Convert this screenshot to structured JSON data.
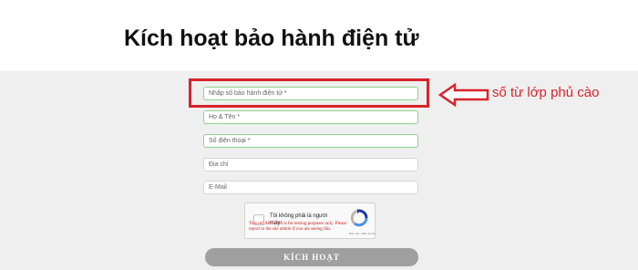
{
  "header": {
    "title": "Kích hoạt bảo hành điện tử"
  },
  "form": {
    "fields": [
      {
        "placeholder": "Nhập số bảo hành điện tử *"
      },
      {
        "placeholder": "Họ & Tên *"
      },
      {
        "placeholder": "Số điện thoại *"
      },
      {
        "placeholder": "Địa chỉ"
      },
      {
        "placeholder": "E-Mail"
      }
    ],
    "recaptcha": {
      "label": "Tôi không phải là người máy",
      "links": "Bảo mật - Điều khoản",
      "warning": "This reCAPTCHA is for testing purposes only. Please report to the site admin if you are seeing this."
    },
    "submit_label": "KÍCH HOẠT"
  },
  "annotation": {
    "text": "số từ lớp phủ cào",
    "color": "#d8232a"
  },
  "icons": [
    "arrow-left-outline-icon",
    "recaptcha-logo-icon"
  ]
}
